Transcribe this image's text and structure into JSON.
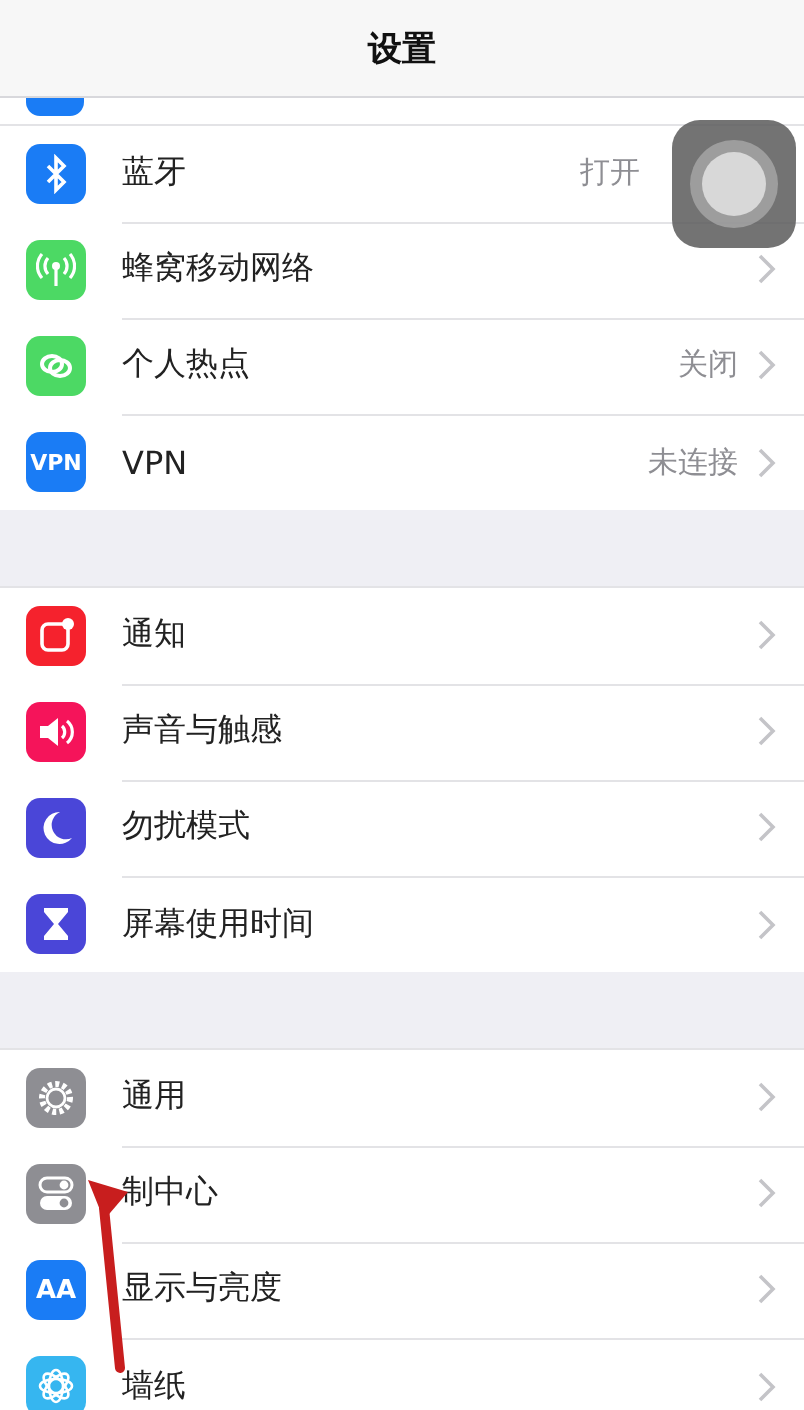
{
  "header": {
    "title": "设置"
  },
  "groups": [
    {
      "rows": [
        {
          "kind": "bluetooth",
          "color": "#1a7cf5",
          "label": "蓝牙",
          "value": "打开",
          "chevron": false
        },
        {
          "kind": "cellular",
          "color": "#4cd964",
          "label": "蜂窝移动网络",
          "chevron": true
        },
        {
          "kind": "hotspot",
          "color": "#4cd964",
          "label": "个人热点",
          "value": "关闭",
          "chevron": true
        },
        {
          "kind": "vpn",
          "color": "#1a7cf5",
          "icon_text": "VPN",
          "label": "VPN",
          "value": "未连接",
          "chevron": true
        }
      ]
    },
    {
      "rows": [
        {
          "kind": "notifications",
          "color": "#f5222d",
          "label": "通知",
          "chevron": true
        },
        {
          "kind": "sounds",
          "color": "#f5145a",
          "label": "声音与触感",
          "chevron": true
        },
        {
          "kind": "moon",
          "color": "#4a46d8",
          "label": "勿扰模式",
          "chevron": true
        },
        {
          "kind": "hourglass",
          "color": "#4a46d8",
          "label": "屏幕使用时间",
          "chevron": true
        }
      ]
    },
    {
      "rows": [
        {
          "kind": "gear",
          "color": "#8e8e93",
          "label": "通用",
          "chevron": true
        },
        {
          "kind": "toggles",
          "color": "#8e8e93",
          "label": "制中心",
          "chevron": true
        },
        {
          "kind": "text",
          "color": "#1a7cf5",
          "icon_text": "AA",
          "label": "显示与亮度",
          "chevron": true
        },
        {
          "kind": "flower",
          "color": "#36b6f0",
          "label": "墙纸",
          "chevron": true
        }
      ]
    }
  ],
  "assistive_touch": {
    "shown": true
  },
  "annotation": {
    "kind": "arrow",
    "color": "#c81e1e"
  }
}
